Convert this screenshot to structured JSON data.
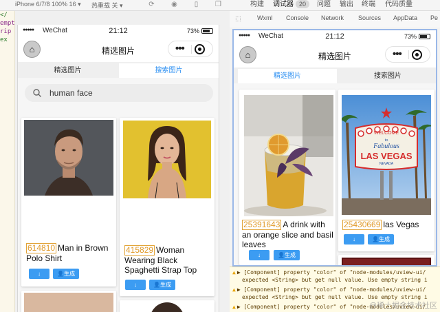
{
  "ide": {
    "device": "iPhone 6/7/8 100% 16 ▾",
    "hot": "热重载 关 ▾",
    "devtools_tabs": [
      {
        "label": "构建"
      },
      {
        "label": "调试器",
        "badge": "20"
      },
      {
        "label": "问题"
      },
      {
        "label": "输出"
      },
      {
        "label": "终端"
      },
      {
        "label": "代码质量"
      }
    ],
    "panel_tabs": [
      "Wxml",
      "Console",
      "Network",
      "Sources",
      "AppData",
      "Pe"
    ],
    "editor_lines": [
      "</",
      "empt",
      "",
      "",
      "rip",
      "ex",
      ""
    ]
  },
  "status": {
    "carrier": "WeChat",
    "time": "21:12",
    "battery": "73%"
  },
  "nav": {
    "title": "精选图片"
  },
  "tabs": {
    "featured": "精选图片",
    "search": "搜索图片"
  },
  "search": {
    "value": "human face"
  },
  "buttons": {
    "download": "↓",
    "generate_icon": "👤",
    "generate": "生成"
  },
  "left_cards": [
    {
      "num": "614810",
      "title": "Man in Brown Polo Shirt"
    },
    {
      "num": "415829",
      "title": "Woman Wearing Black Spaghetti Strap Top"
    }
  ],
  "right_cards": [
    {
      "num": "25391643",
      "title": "A drink with an orange slice and basil leaves"
    },
    {
      "num": "25430669",
      "title": "las Vegas"
    }
  ],
  "vegas_sign": {
    "welcome": "WELCOME",
    "to": "to",
    "fabulous": "Fabulous",
    "city": "LAS VEGAS",
    "state": "NEVADA"
  },
  "console": {
    "lines": [
      "▶ [Component] property \"color\" of \"node-modules/uview-ui/",
      "expected <String> but get null value. Use empty string i",
      "▶ [Component] property \"color\" of \"node-modules/uview-ui/",
      "expected <String> but get null value. Use empty string i",
      "▶ [Component] property \"color\" of \"node-modules/uview-ui/"
    ],
    "watermark": "@稀土掘金技术社区"
  }
}
